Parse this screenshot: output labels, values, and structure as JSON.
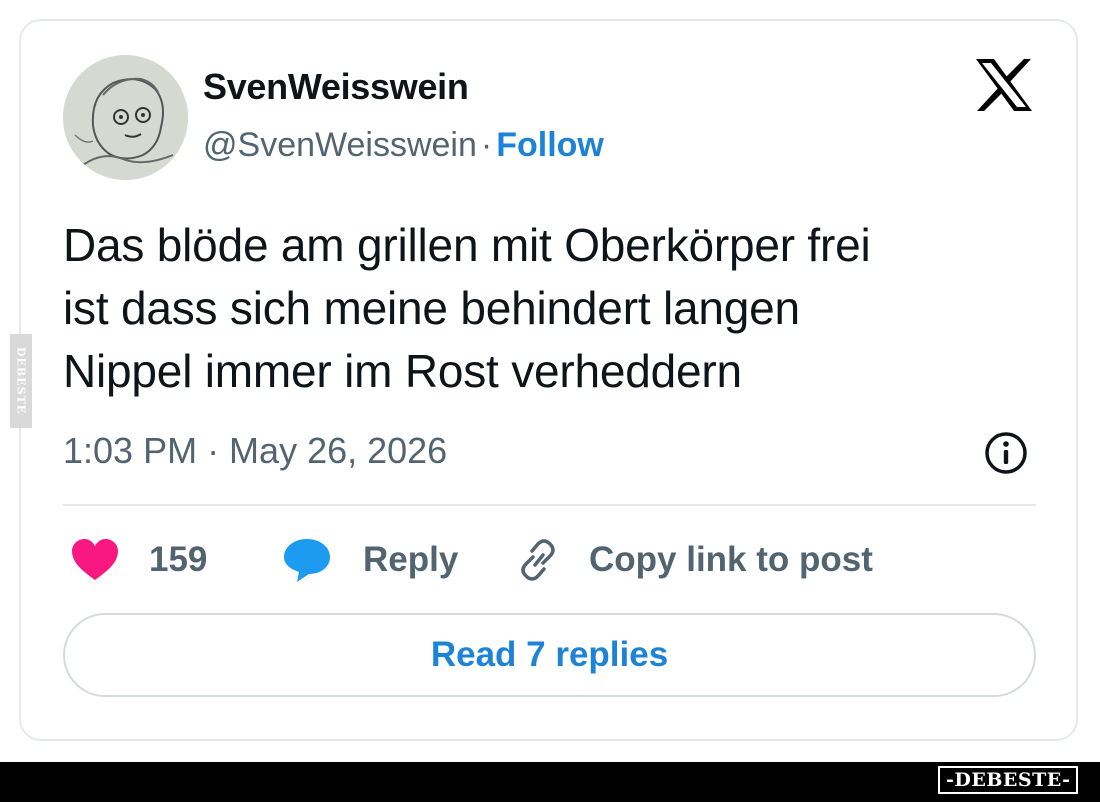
{
  "tweet": {
    "display_name": "SvenWeisswein",
    "handle": "@SvenWeisswein",
    "separator": "·",
    "follow_label": "Follow",
    "text_lines": [
      "Das blöde am grillen mit Oberkörper frei",
      "ist dass sich meine behindert langen",
      "Nippel immer im Rost verheddern"
    ],
    "timestamp": "1:03 PM · May 26, 2026"
  },
  "actions": {
    "like_count": "159",
    "reply_label": "Reply",
    "copy_label": "Copy link to post"
  },
  "read_replies_label": "Read 7 replies",
  "watermark": {
    "side_text": "DEBESTE",
    "footer_text": "-DEBESTE-"
  },
  "icons": {
    "brand": "x-logo-icon",
    "info": "info-icon",
    "like": "heart-icon",
    "reply": "speech-bubble-icon",
    "copy": "link-icon"
  },
  "colors": {
    "link_blue": "#1d83d6",
    "heart_pink": "#f91880",
    "bubble_blue": "#1d9bf0",
    "secondary_text": "#536471"
  }
}
